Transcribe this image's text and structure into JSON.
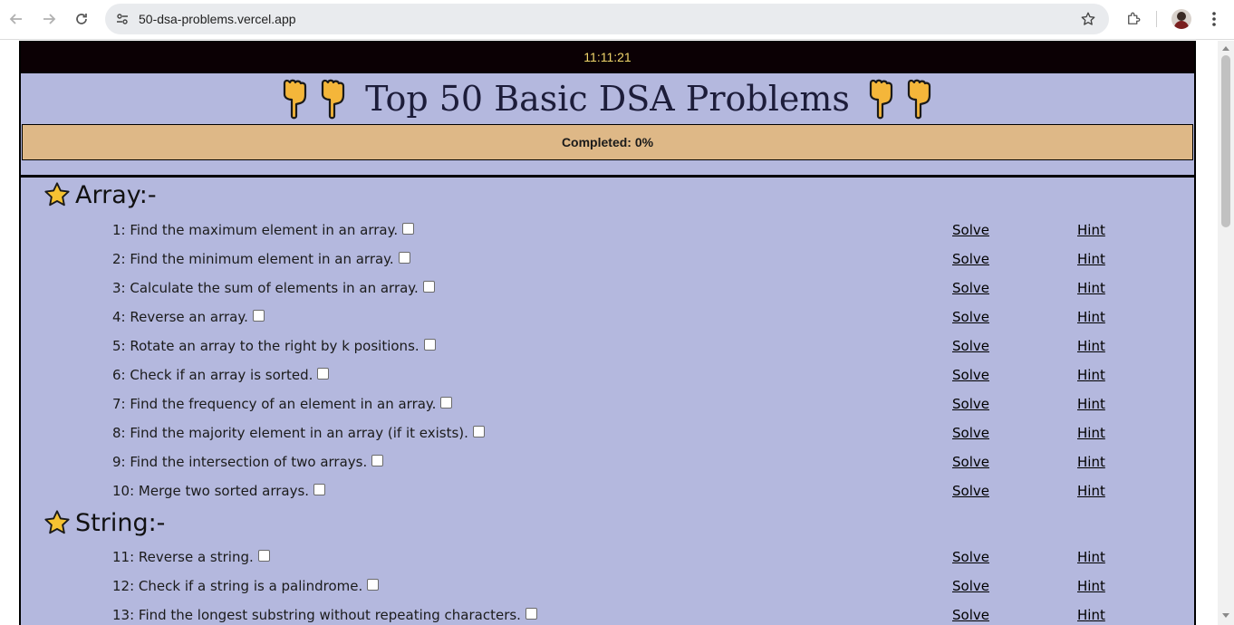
{
  "browser": {
    "url": "50-dsa-problems.vercel.app",
    "icons": {
      "back": "back-arrow-icon",
      "forward": "forward-arrow-icon",
      "reload": "reload-icon",
      "site_info": "site-info-icon",
      "bookmark": "star-icon",
      "extensions": "puzzle-icon",
      "menu": "kebab-menu-icon"
    }
  },
  "header": {
    "clock": "11:11:21",
    "title": "Top 50 Basic DSA Problems",
    "completed": "Completed: 0%"
  },
  "colors": {
    "page_bg": "#b4b8de",
    "clock_bg": "#0b0004",
    "clock_text": "#f0d56b",
    "progress_bg": "#deb887"
  },
  "sections": [
    {
      "heading": "Array:-",
      "problems": [
        {
          "text": "1: Find the maximum element in an array.",
          "solve": "Solve",
          "hint": "Hint",
          "checked": false
        },
        {
          "text": "2: Find the minimum element in an array.",
          "solve": "Solve",
          "hint": "Hint",
          "checked": false
        },
        {
          "text": "3: Calculate the sum of elements in an array.",
          "solve": "Solve",
          "hint": "Hint",
          "checked": false
        },
        {
          "text": "4: Reverse an array.",
          "solve": "Solve",
          "hint": "Hint",
          "checked": false
        },
        {
          "text": "5: Rotate an array to the right by k positions.",
          "solve": "Solve",
          "hint": "Hint",
          "checked": false
        },
        {
          "text": "6: Check if an array is sorted.",
          "solve": "Solve",
          "hint": "Hint",
          "checked": false
        },
        {
          "text": "7: Find the frequency of an element in an array.",
          "solve": "Solve",
          "hint": "Hint",
          "checked": false
        },
        {
          "text": "8: Find the majority element in an array (if it exists).",
          "solve": "Solve",
          "hint": "Hint",
          "checked": false
        },
        {
          "text": "9: Find the intersection of two arrays.",
          "solve": "Solve",
          "hint": "Hint",
          "checked": false
        },
        {
          "text": "10: Merge two sorted arrays.",
          "solve": "Solve",
          "hint": "Hint",
          "checked": false
        }
      ]
    },
    {
      "heading": "String:-",
      "problems": [
        {
          "text": "11: Reverse a string.",
          "solve": "Solve",
          "hint": "Hint",
          "checked": false
        },
        {
          "text": "12: Check if a string is a palindrome.",
          "solve": "Solve",
          "hint": "Hint",
          "checked": false
        },
        {
          "text": "13: Find the longest substring without repeating characters.",
          "solve": "Solve",
          "hint": "Hint",
          "checked": false
        }
      ]
    }
  ]
}
